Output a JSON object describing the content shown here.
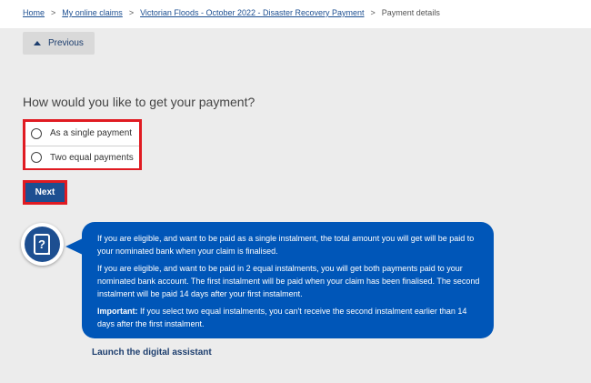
{
  "breadcrumb": {
    "items": [
      "Home",
      "My online claims",
      "Victorian Floods - October 2022 - Disaster Recovery Payment"
    ],
    "current": "Payment details",
    "separator": ">"
  },
  "nav": {
    "previous_label": "Previous"
  },
  "form": {
    "question": "How would you like to get your payment?",
    "options": [
      {
        "label": "As a single payment",
        "selected": false
      },
      {
        "label": "Two equal payments",
        "selected": false
      }
    ],
    "next_label": "Next"
  },
  "assistant": {
    "icon": "help-book-icon",
    "para1": "If you are eligible, and want to be paid as a single instalment, the total amount you will get will be paid to your nominated bank when your claim is finalised.",
    "para2": "If you are eligible, and want to be paid in 2 equal instalments, you will get both payments paid to your nominated bank account. The first instalment will be paid when your claim has been finalised. The second instalment will be paid 14 days after your first instalment.",
    "important_label": "Important:",
    "important_text": " If you select two equal instalments, you can't receive the second instalment earlier than 14 days after the first instalment.",
    "launch_label": "Launch the digital assistant"
  },
  "colors": {
    "page_bg": "#ececec",
    "primary": "#1d4f91",
    "bubble": "#0056b8",
    "highlight": "#e01b22"
  }
}
